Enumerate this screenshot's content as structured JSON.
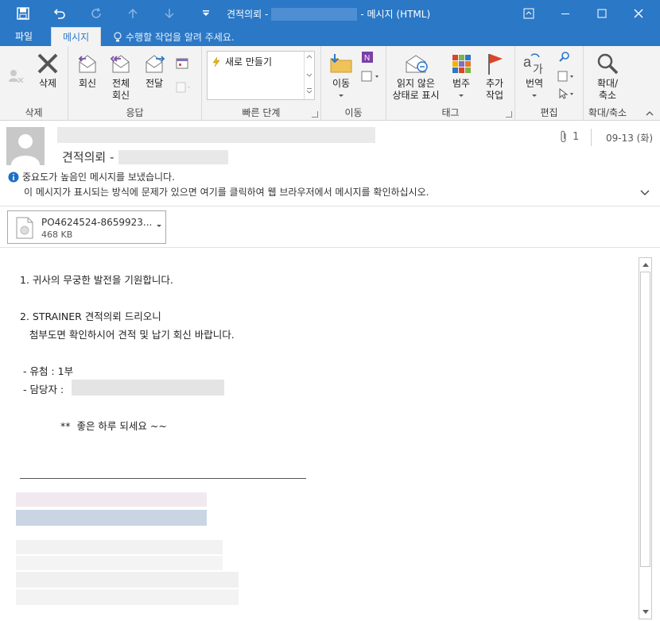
{
  "window": {
    "title_prefix": "견적의뢰 -",
    "title_suffix": "- 메시지 (HTML)"
  },
  "tabs": {
    "file": "파일",
    "message": "메시지"
  },
  "tell_me": "수행할 작업을 알려 주세요.",
  "ribbon": {
    "groups": {
      "delete": "삭제",
      "respond": "응답",
      "quick_steps": "빠른 단계",
      "move": "이동",
      "tags": "태그",
      "editing": "편집",
      "zoom": "확대/축소"
    },
    "buttons": {
      "delete": "삭제",
      "reply": "회신",
      "reply_all_1": "전체",
      "reply_all_2": "회신",
      "forward": "전달",
      "move": "이동",
      "mark_unread_1": "읽지 않은",
      "mark_unread_2": "상태로 표시",
      "categorize": "범주",
      "followup_1": "추가",
      "followup_2": "작업",
      "translate": "번역",
      "zoom_1": "확대/",
      "zoom_2": "축소"
    },
    "quick_steps_item": "새로 만들기"
  },
  "header": {
    "subject_prefix": "견적의뢰 -",
    "attachment_count": "1",
    "date": "09-13 (화)",
    "info_line1": "중요도가 높음인 메시지를 보냈습니다.",
    "info_line2": "이 메시지가 표시되는 방식에 문제가 있으면 여기를 클릭하여 웹 브라우저에서 메시지를 확인하십시오."
  },
  "attachment": {
    "name": "PO4624524-8659923...",
    "size": "468 KB"
  },
  "message_body": {
    "line1": "1. 귀사의 무궁한 발전을 기원합니다.",
    "line2": "2. STRAINER 견적의뢰 드리오니",
    "line3": "   첨부도면 확인하시어 견적 및 납기 회신 바랍니다.",
    "line4": " - 유첨 : 1부",
    "line5": " - 담당자 :",
    "line6": "**  좋은 하루 되세요 ~~"
  },
  "colors": {
    "accent": "#2b78c6",
    "ribbon_bg": "#f3f3f3",
    "flag_red": "#d9452b",
    "info_blue": "#1e6fc5"
  }
}
